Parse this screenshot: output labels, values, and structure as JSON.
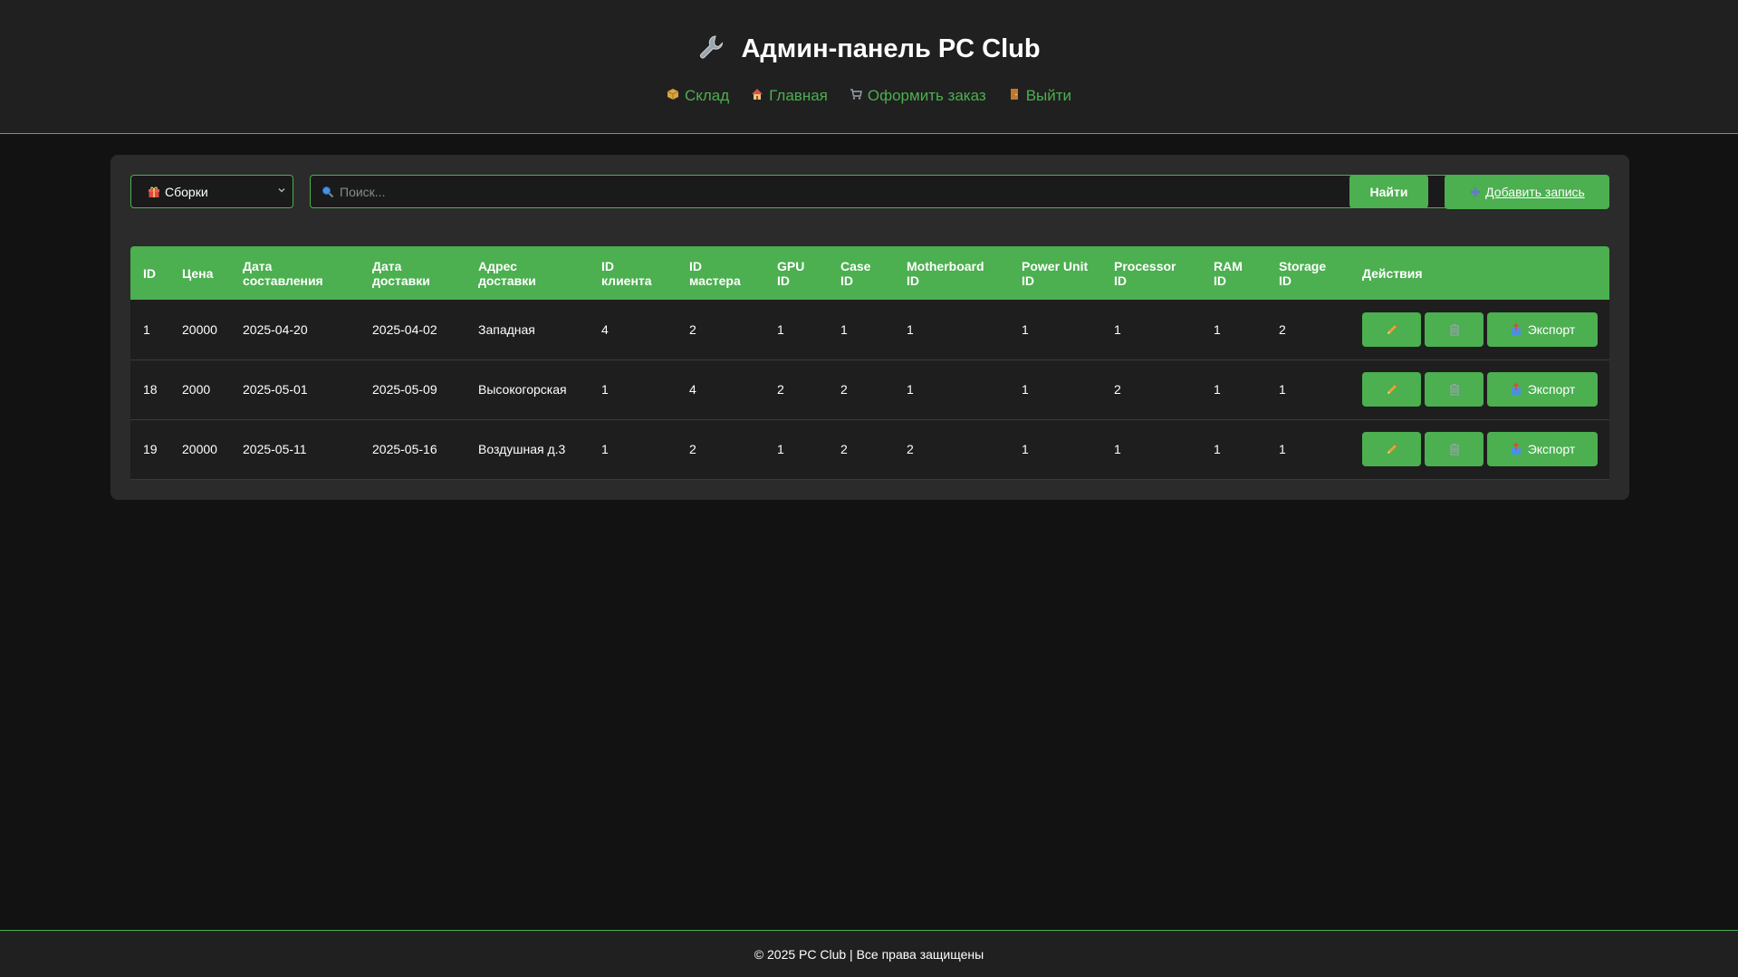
{
  "header": {
    "title": "Админ-панель PC Club",
    "title_icon": "wrench-icon",
    "nav": [
      {
        "label": "Склад",
        "icon": "package-icon"
      },
      {
        "label": "Главная",
        "icon": "house-icon"
      },
      {
        "label": "Оформить заказ",
        "icon": "cart-icon"
      },
      {
        "label": "Выйти",
        "icon": "door-icon"
      }
    ]
  },
  "toolbar": {
    "category_select_value": "Сборки",
    "category_icon": "gift-icon",
    "search_placeholder": "Поиск...",
    "find_label": "Найти",
    "add_label": "Добавить запись"
  },
  "table": {
    "columns": [
      [
        "ID",
        ""
      ],
      [
        "Цена",
        ""
      ],
      [
        "Дата",
        "составления"
      ],
      [
        "Дата",
        "доставки"
      ],
      [
        "Адрес",
        "доставки"
      ],
      [
        "ID",
        "клиента"
      ],
      [
        "ID",
        "мастера"
      ],
      [
        "GPU",
        "ID"
      ],
      [
        "Case",
        "ID"
      ],
      [
        "Motherboard",
        "ID"
      ],
      [
        "Power Unit",
        "ID"
      ],
      [
        "Processor",
        "ID"
      ],
      [
        "RAM",
        "ID"
      ],
      [
        "Storage",
        "ID"
      ],
      [
        "Действия",
        ""
      ]
    ],
    "rows": [
      [
        "1",
        "20000",
        "2025-04-20",
        "2025-04-02",
        "Западная",
        "4",
        "2",
        "1",
        "1",
        "1",
        "1",
        "1",
        "1",
        "2"
      ],
      [
        "18",
        "2000",
        "2025-05-01",
        "2025-05-09",
        "Высокогорская",
        "1",
        "4",
        "2",
        "2",
        "1",
        "1",
        "2",
        "1",
        "1"
      ],
      [
        "19",
        "20000",
        "2025-05-11",
        "2025-05-16",
        "Воздушная д.3",
        "1",
        "2",
        "1",
        "2",
        "2",
        "1",
        "1",
        "1",
        "1"
      ]
    ],
    "export_label": "Экспорт"
  },
  "footer": {
    "text": "© 2025 PC Club | Все права защищены"
  },
  "colors": {
    "accent": "#4caf50",
    "background": "#121212",
    "panel": "#2b2b2b",
    "header": "#202020"
  }
}
